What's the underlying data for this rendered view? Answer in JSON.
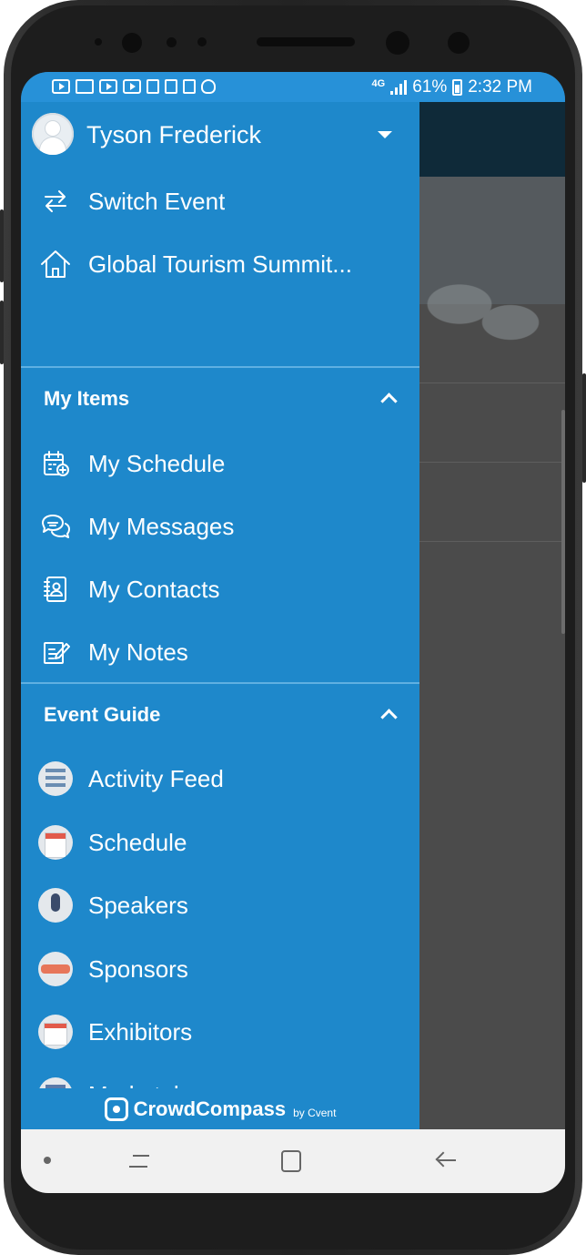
{
  "status_bar": {
    "network": "4G",
    "battery": "61%",
    "time": "2:32 PM",
    "notification_icons": [
      "youtube-icon",
      "gmail-icon",
      "youtube-icon",
      "youtube-icon",
      "calendar-icon",
      "pencil-icon",
      "phone-icon",
      "snapchat-icon"
    ]
  },
  "drawer": {
    "user_name": "Tyson Frederick",
    "top_items": [
      {
        "label": "Switch Event",
        "icon": "switch-arrows-icon"
      },
      {
        "label": "Global Tourism Summit...",
        "icon": "home-icon"
      }
    ],
    "my_items": {
      "title": "My Items",
      "items": [
        {
          "label": "My Schedule",
          "icon": "calendar-plus-icon"
        },
        {
          "label": "My Messages",
          "icon": "chat-bubbles-icon"
        },
        {
          "label": "My Contacts",
          "icon": "contact-book-icon"
        },
        {
          "label": "My Notes",
          "icon": "note-pencil-icon"
        }
      ]
    },
    "event_guide": {
      "title": "Event Guide",
      "items": [
        {
          "label": "Activity Feed",
          "icon": "activity-feed-icon"
        },
        {
          "label": "Schedule",
          "icon": "schedule-icon"
        },
        {
          "label": "Speakers",
          "icon": "microphone-icon"
        },
        {
          "label": "Sponsors",
          "icon": "handshake-icon"
        },
        {
          "label": "Exhibitors",
          "icon": "exhibitor-badge-icon"
        },
        {
          "label": "Marketplaces",
          "icon": "storefront-icon"
        }
      ]
    },
    "brand": {
      "name": "CrowdCompass",
      "by": "by Cvent"
    }
  },
  "colors": {
    "drawer_bg": "#1e88cb",
    "status_bar": "#2791d8",
    "background_app": "#4b4b4b"
  }
}
